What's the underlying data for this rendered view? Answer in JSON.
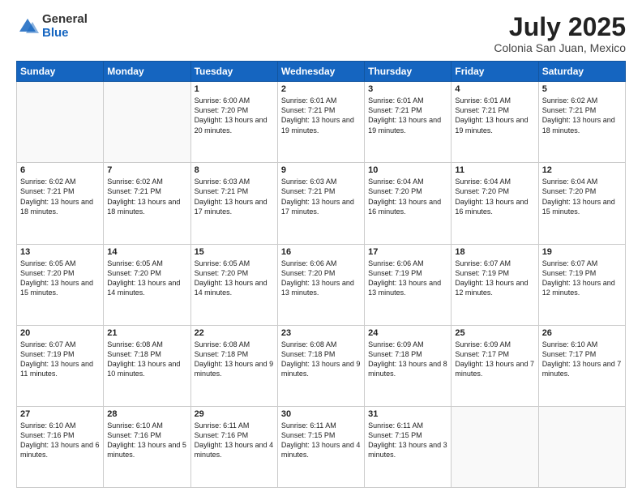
{
  "header": {
    "logo_general": "General",
    "logo_blue": "Blue",
    "month_year": "July 2025",
    "location": "Colonia San Juan, Mexico"
  },
  "days_of_week": [
    "Sunday",
    "Monday",
    "Tuesday",
    "Wednesday",
    "Thursday",
    "Friday",
    "Saturday"
  ],
  "weeks": [
    [
      {
        "day": "",
        "info": ""
      },
      {
        "day": "",
        "info": ""
      },
      {
        "day": "1",
        "info": "Sunrise: 6:00 AM\nSunset: 7:20 PM\nDaylight: 13 hours and 20 minutes."
      },
      {
        "day": "2",
        "info": "Sunrise: 6:01 AM\nSunset: 7:21 PM\nDaylight: 13 hours and 19 minutes."
      },
      {
        "day": "3",
        "info": "Sunrise: 6:01 AM\nSunset: 7:21 PM\nDaylight: 13 hours and 19 minutes."
      },
      {
        "day": "4",
        "info": "Sunrise: 6:01 AM\nSunset: 7:21 PM\nDaylight: 13 hours and 19 minutes."
      },
      {
        "day": "5",
        "info": "Sunrise: 6:02 AM\nSunset: 7:21 PM\nDaylight: 13 hours and 18 minutes."
      }
    ],
    [
      {
        "day": "6",
        "info": "Sunrise: 6:02 AM\nSunset: 7:21 PM\nDaylight: 13 hours and 18 minutes."
      },
      {
        "day": "7",
        "info": "Sunrise: 6:02 AM\nSunset: 7:21 PM\nDaylight: 13 hours and 18 minutes."
      },
      {
        "day": "8",
        "info": "Sunrise: 6:03 AM\nSunset: 7:21 PM\nDaylight: 13 hours and 17 minutes."
      },
      {
        "day": "9",
        "info": "Sunrise: 6:03 AM\nSunset: 7:21 PM\nDaylight: 13 hours and 17 minutes."
      },
      {
        "day": "10",
        "info": "Sunrise: 6:04 AM\nSunset: 7:20 PM\nDaylight: 13 hours and 16 minutes."
      },
      {
        "day": "11",
        "info": "Sunrise: 6:04 AM\nSunset: 7:20 PM\nDaylight: 13 hours and 16 minutes."
      },
      {
        "day": "12",
        "info": "Sunrise: 6:04 AM\nSunset: 7:20 PM\nDaylight: 13 hours and 15 minutes."
      }
    ],
    [
      {
        "day": "13",
        "info": "Sunrise: 6:05 AM\nSunset: 7:20 PM\nDaylight: 13 hours and 15 minutes."
      },
      {
        "day": "14",
        "info": "Sunrise: 6:05 AM\nSunset: 7:20 PM\nDaylight: 13 hours and 14 minutes."
      },
      {
        "day": "15",
        "info": "Sunrise: 6:05 AM\nSunset: 7:20 PM\nDaylight: 13 hours and 14 minutes."
      },
      {
        "day": "16",
        "info": "Sunrise: 6:06 AM\nSunset: 7:20 PM\nDaylight: 13 hours and 13 minutes."
      },
      {
        "day": "17",
        "info": "Sunrise: 6:06 AM\nSunset: 7:19 PM\nDaylight: 13 hours and 13 minutes."
      },
      {
        "day": "18",
        "info": "Sunrise: 6:07 AM\nSunset: 7:19 PM\nDaylight: 13 hours and 12 minutes."
      },
      {
        "day": "19",
        "info": "Sunrise: 6:07 AM\nSunset: 7:19 PM\nDaylight: 13 hours and 12 minutes."
      }
    ],
    [
      {
        "day": "20",
        "info": "Sunrise: 6:07 AM\nSunset: 7:19 PM\nDaylight: 13 hours and 11 minutes."
      },
      {
        "day": "21",
        "info": "Sunrise: 6:08 AM\nSunset: 7:18 PM\nDaylight: 13 hours and 10 minutes."
      },
      {
        "day": "22",
        "info": "Sunrise: 6:08 AM\nSunset: 7:18 PM\nDaylight: 13 hours and 9 minutes."
      },
      {
        "day": "23",
        "info": "Sunrise: 6:08 AM\nSunset: 7:18 PM\nDaylight: 13 hours and 9 minutes."
      },
      {
        "day": "24",
        "info": "Sunrise: 6:09 AM\nSunset: 7:18 PM\nDaylight: 13 hours and 8 minutes."
      },
      {
        "day": "25",
        "info": "Sunrise: 6:09 AM\nSunset: 7:17 PM\nDaylight: 13 hours and 7 minutes."
      },
      {
        "day": "26",
        "info": "Sunrise: 6:10 AM\nSunset: 7:17 PM\nDaylight: 13 hours and 7 minutes."
      }
    ],
    [
      {
        "day": "27",
        "info": "Sunrise: 6:10 AM\nSunset: 7:16 PM\nDaylight: 13 hours and 6 minutes."
      },
      {
        "day": "28",
        "info": "Sunrise: 6:10 AM\nSunset: 7:16 PM\nDaylight: 13 hours and 5 minutes."
      },
      {
        "day": "29",
        "info": "Sunrise: 6:11 AM\nSunset: 7:16 PM\nDaylight: 13 hours and 4 minutes."
      },
      {
        "day": "30",
        "info": "Sunrise: 6:11 AM\nSunset: 7:15 PM\nDaylight: 13 hours and 4 minutes."
      },
      {
        "day": "31",
        "info": "Sunrise: 6:11 AM\nSunset: 7:15 PM\nDaylight: 13 hours and 3 minutes."
      },
      {
        "day": "",
        "info": ""
      },
      {
        "day": "",
        "info": ""
      }
    ]
  ]
}
